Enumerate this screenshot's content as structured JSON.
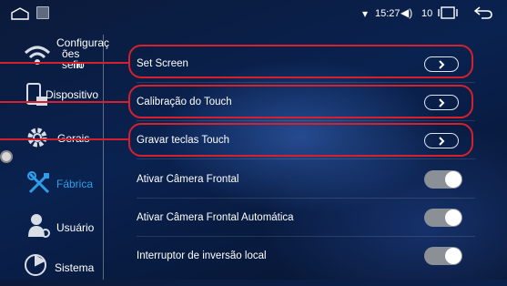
{
  "status": {
    "time": "15:27",
    "volume": "10",
    "icons": [
      "home-icon",
      "image-icon",
      "wifi-icon",
      "volume-icon",
      "recent-apps-icon",
      "back-icon"
    ]
  },
  "sidebar": {
    "items": [
      {
        "label_line1": "Configuraç",
        "label_line2": "ões sem",
        "label_line3": "fio",
        "icon": "wifi-icon",
        "active": false
      },
      {
        "label": "Dispositivo",
        "icon": "device-icon",
        "active": false
      },
      {
        "label": "Gerais",
        "icon": "gear-icon",
        "active": false
      },
      {
        "label": "Fábrica",
        "icon": "tools-icon",
        "active": true
      },
      {
        "label": "Usuário",
        "icon": "user-settings-icon",
        "active": false
      },
      {
        "label": "Sistema",
        "icon": "system-icon",
        "active": false
      }
    ]
  },
  "settings": {
    "rows": [
      {
        "title": "Set Screen",
        "control": "arrow"
      },
      {
        "title": "Calibração do Touch",
        "control": "arrow"
      },
      {
        "title": "Gravar teclas Touch",
        "control": "arrow"
      },
      {
        "title": "Ativar Câmera Frontal",
        "control": "toggle",
        "state": "on"
      },
      {
        "title": "Ativar Câmera Frontal Automática",
        "control": "toggle",
        "state": "on"
      },
      {
        "title": "Interruptor de inversão local",
        "control": "toggle",
        "state": "on"
      }
    ]
  },
  "colors": {
    "accent": "#2f9ee8",
    "highlight": "#d6202c",
    "toggle_track": "#8b8f96",
    "background": "#0a2250"
  }
}
